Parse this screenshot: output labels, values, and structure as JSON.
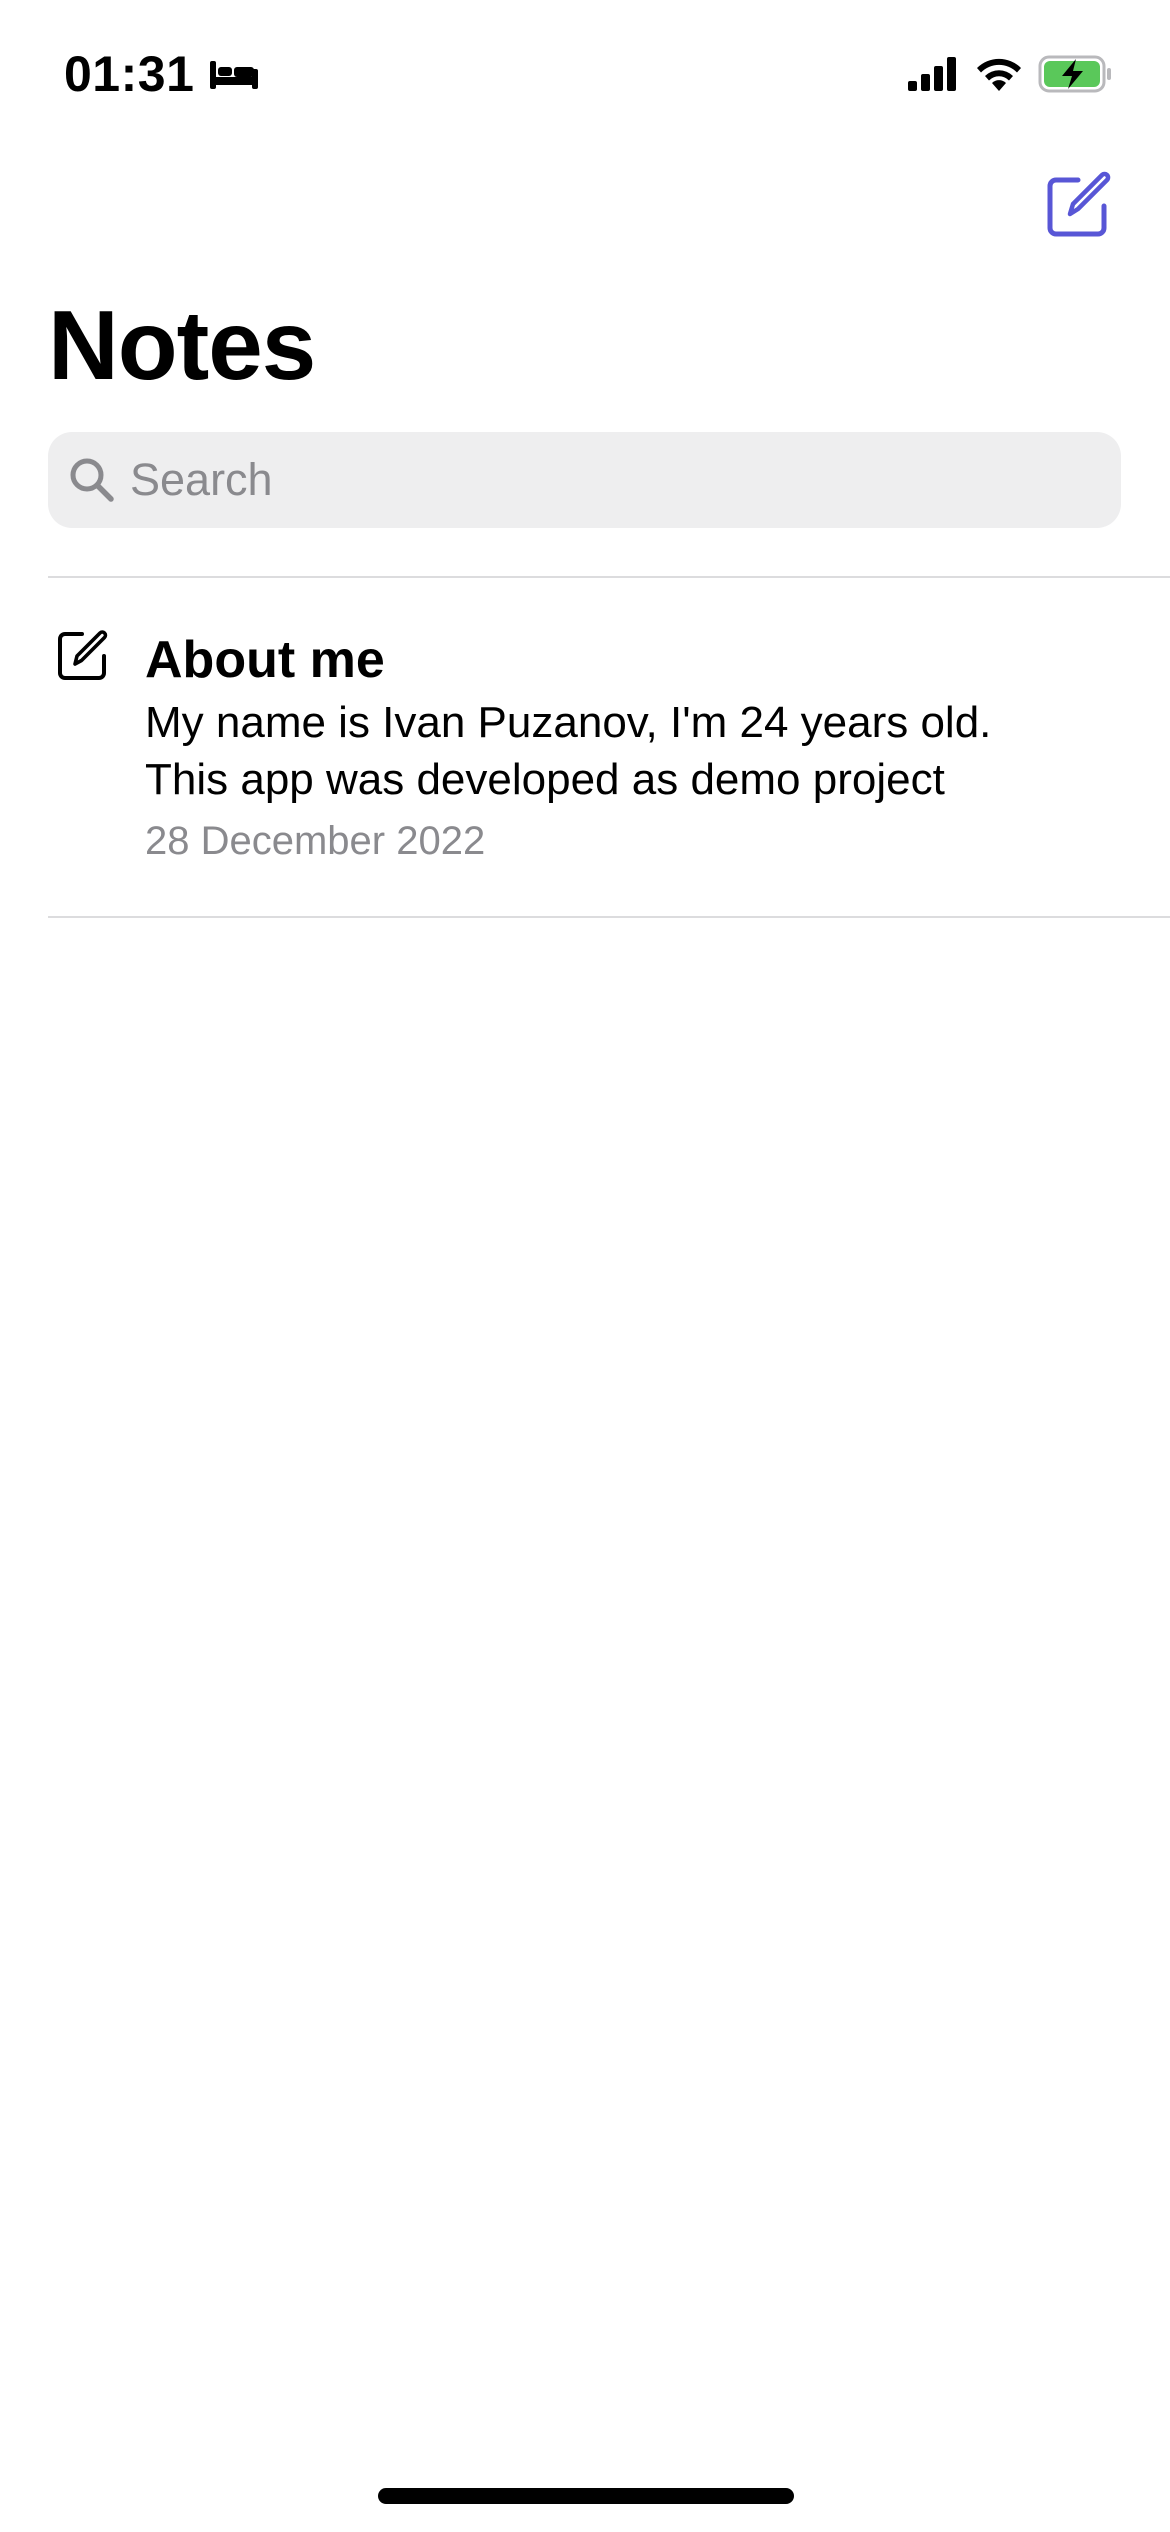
{
  "status_bar": {
    "time": "01:31",
    "focus_icon": "bed-icon",
    "battery_color": "#5ac85a",
    "battery_state": "charging"
  },
  "nav": {
    "compose_icon": "compose-icon",
    "accent_color": "#5856d6"
  },
  "page": {
    "title": "Notes"
  },
  "search": {
    "placeholder": "Search",
    "value": ""
  },
  "notes": [
    {
      "icon": "note-edit-icon",
      "title": "About me",
      "preview": "My name is Ivan Puzanov, I'm 24 years old. This app was developed as demo project",
      "date": "28 December 2022"
    }
  ]
}
